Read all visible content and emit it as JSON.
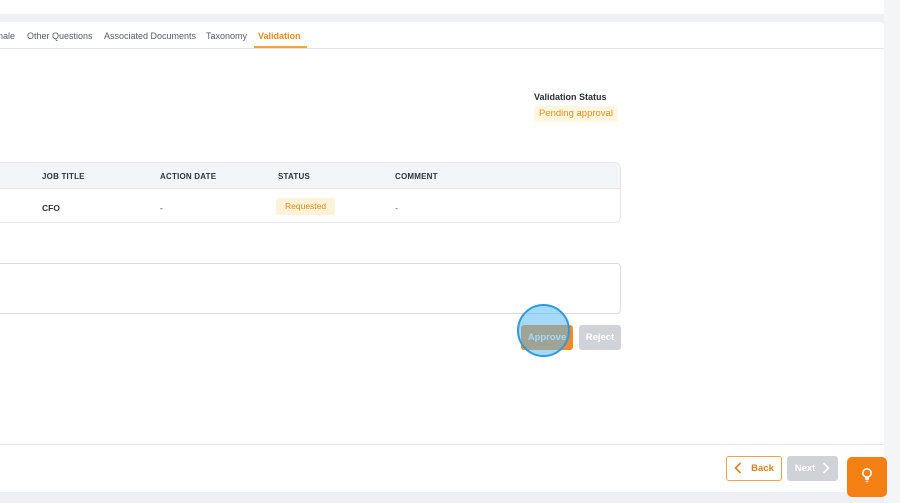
{
  "tabs": {
    "items": [
      {
        "label": "nale",
        "active": false
      },
      {
        "label": "Other Questions",
        "active": false
      },
      {
        "label": "Associated Documents",
        "active": false
      },
      {
        "label": "Taxonomy",
        "active": false
      },
      {
        "label": "Validation",
        "active": true
      }
    ]
  },
  "validation": {
    "label": "Validation Status",
    "status": "Pending approval"
  },
  "table": {
    "headers": [
      "JOB TITLE",
      "ACTION DATE",
      "STATUS",
      "COMMENT"
    ],
    "rows": [
      {
        "job_title": "CFO",
        "action_date": "-",
        "status": "Requested",
        "comment": "-"
      }
    ]
  },
  "comment": {
    "placeholder": ""
  },
  "actions": {
    "approve_label": "Approve",
    "reject_label": "Reject"
  },
  "footer": {
    "back_label": "Back",
    "next_label": "Next"
  },
  "colors": {
    "accent": "#f38a2a",
    "active_tab": "#e68a1a",
    "pending_bg": "#fff6e2",
    "disabled": "#cfd2d6"
  },
  "icons": {
    "back": "chevron-left-icon",
    "next": "chevron-right-icon",
    "help": "lightbulb-icon"
  }
}
